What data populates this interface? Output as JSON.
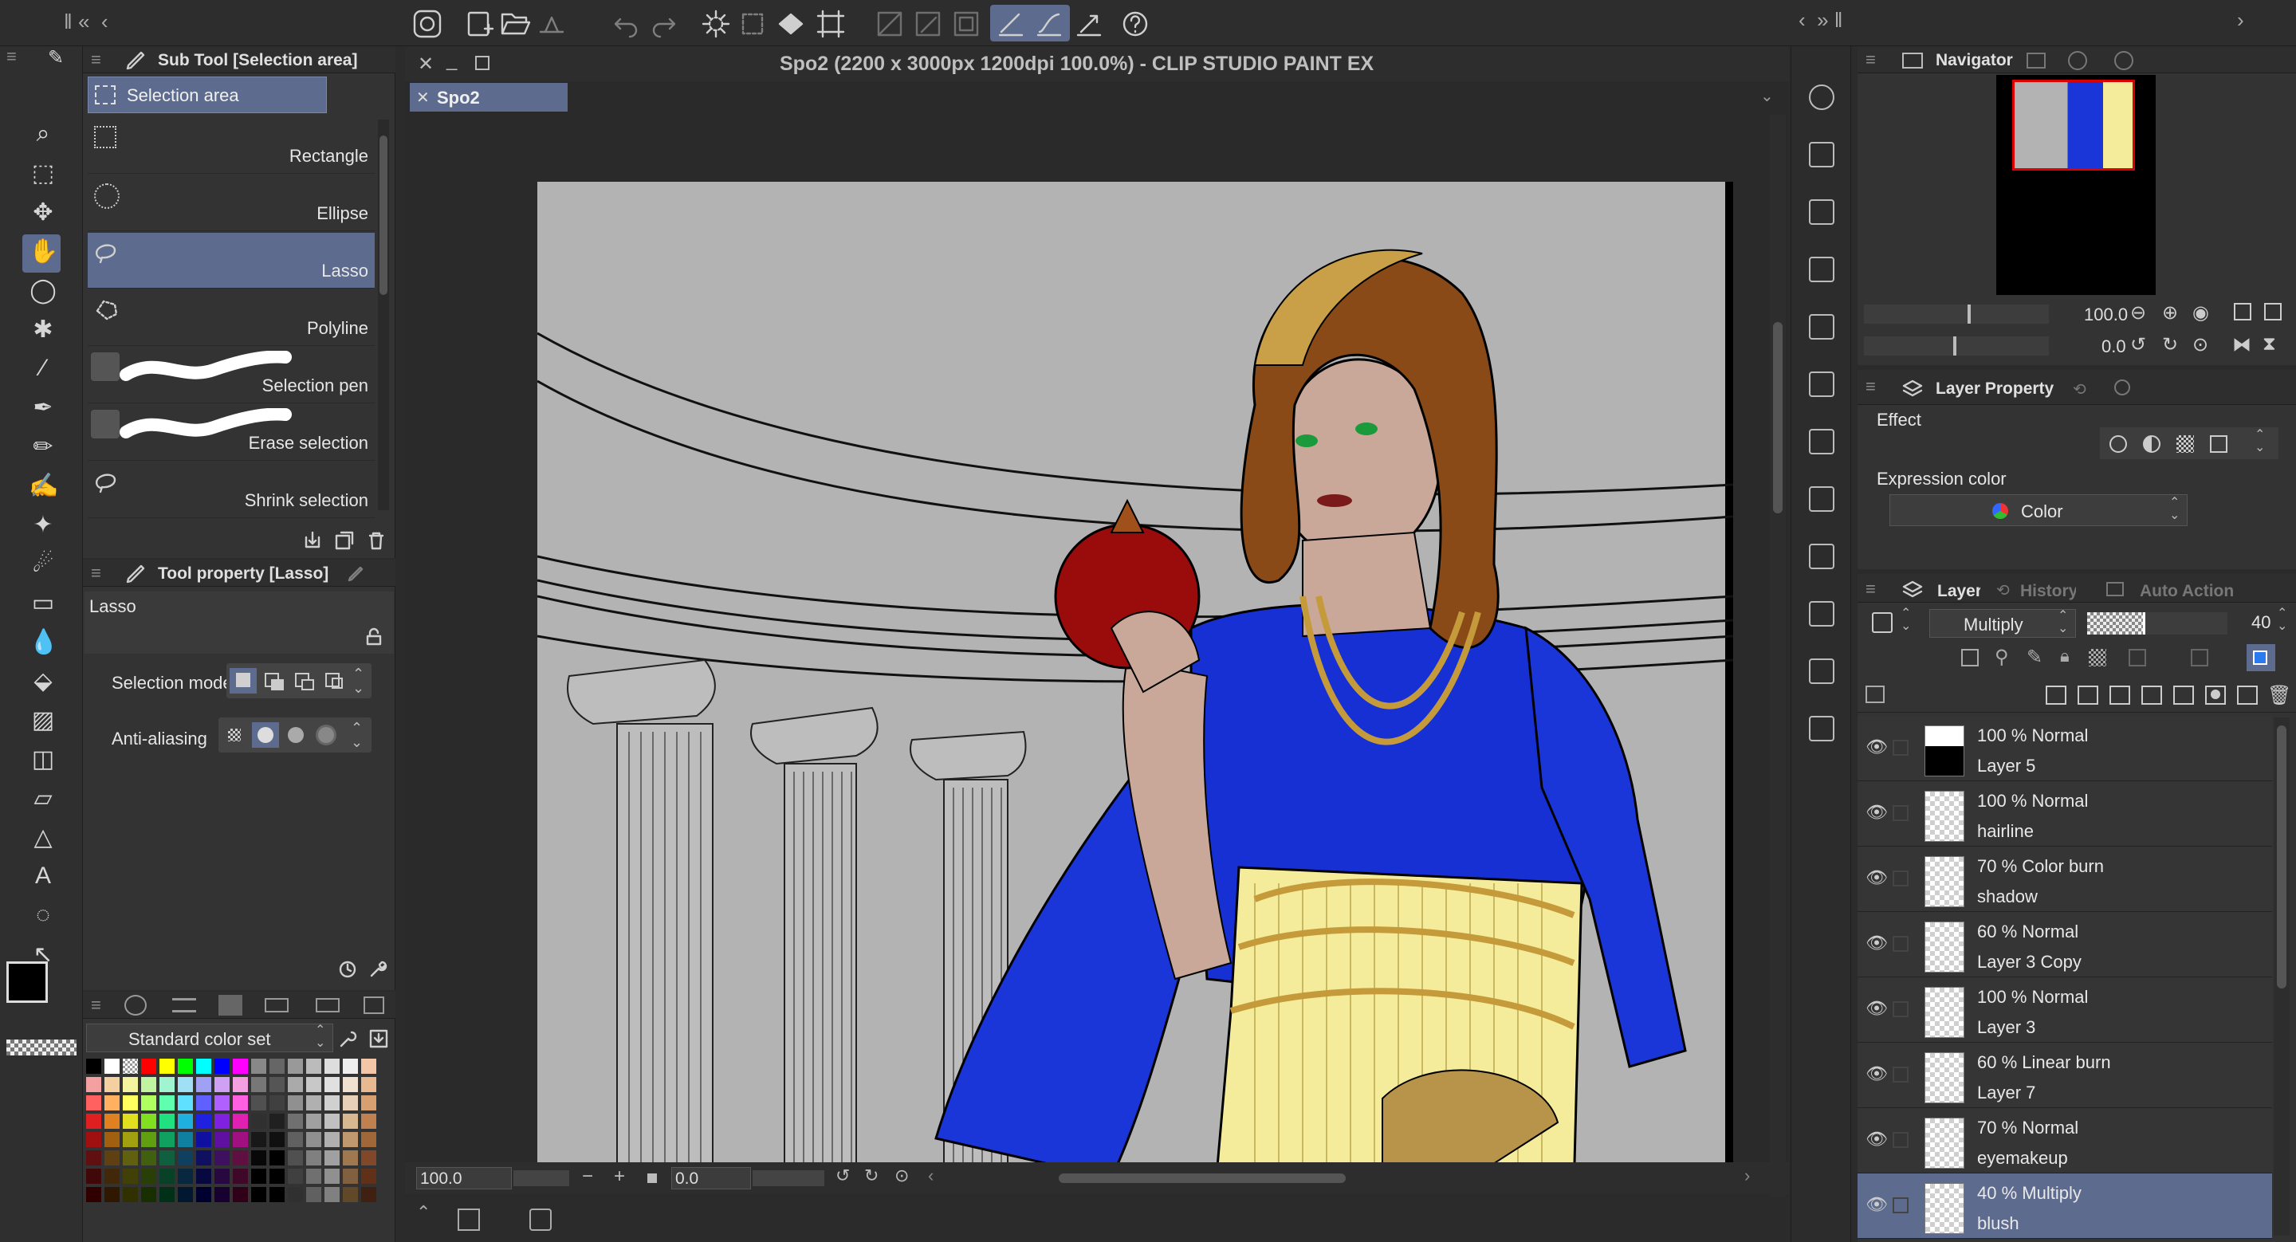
{
  "window": {
    "title": "Spo2 (2200 x 3000px 1200dpi 100.0%)  - CLIP STUDIO PAINT EX",
    "canvas_tab": "Spo2"
  },
  "sub_tool": {
    "header": "Sub Tool [Selection area]",
    "group_tab": "Selection area",
    "items": [
      {
        "label": "Rectangle"
      },
      {
        "label": "Ellipse"
      },
      {
        "label": "Lasso"
      },
      {
        "label": "Polyline"
      },
      {
        "label": "Selection pen"
      },
      {
        "label": "Erase selection"
      },
      {
        "label": "Shrink selection"
      }
    ]
  },
  "tool_property": {
    "header": "Tool property [Lasso]",
    "tool_name": "Lasso",
    "selection_mode_label": "Selection mode",
    "antialiasing_label": "Anti-aliasing"
  },
  "color_set": {
    "name": "Standard color set"
  },
  "status_bar": {
    "zoom": "100.0",
    "rotation": "0.0"
  },
  "navigator": {
    "title": "Navigator",
    "zoom": "100.0",
    "rotation": "0.0"
  },
  "layer_property": {
    "title": "Layer Property",
    "effect_label": "Effect",
    "expression_color_label": "Expression color",
    "expression_color_value": "Color"
  },
  "layer_panel": {
    "tabs": [
      "Layer",
      "History",
      "Auto Action"
    ],
    "blend_mode": "Multiply",
    "opacity": "40",
    "layers": [
      {
        "mode": "100 %  Normal",
        "name": "Layer 5"
      },
      {
        "mode": "100 %  Normal",
        "name": "hairline"
      },
      {
        "mode": "70 %  Color burn",
        "name": "shadow"
      },
      {
        "mode": "60 %  Normal",
        "name": "Layer 3 Copy"
      },
      {
        "mode": "100 %  Normal",
        "name": "Layer 3"
      },
      {
        "mode": "60 %  Linear burn",
        "name": "Layer 7"
      },
      {
        "mode": "70 %  Normal",
        "name": "eyemakeup"
      },
      {
        "mode": "40 %  Multiply",
        "name": "blush"
      }
    ]
  },
  "colors": {
    "accent": "#5d6b8e",
    "panel": "#333333",
    "background": "#2b2b2b",
    "canvas_bg": "#b3b3b3",
    "dress_blue": "#1830d8",
    "skirt_yellow": "#f4ec9a"
  },
  "icons": {
    "toolbar": [
      "app-logo-icon",
      "new-icon",
      "open-icon",
      "save-icon",
      "undo-icon",
      "redo-icon",
      "brightness-icon",
      "crop-icon",
      "fill-icon",
      "transform-icon",
      "snap-ruler-icon",
      "snap-special-icon",
      "snap-grid-icon",
      "help-icon"
    ],
    "tools": [
      "pen-icon",
      "zoom-icon",
      "operation-icon",
      "move-icon",
      "hand-icon",
      "lasso-icon",
      "auto-select-icon",
      "eyedropper-icon",
      "pen2-icon",
      "pencil-icon",
      "brush-icon",
      "decoration-icon",
      "airbrush-icon",
      "eraser-icon",
      "blend-icon",
      "fill-icon",
      "gradient-icon",
      "figure-icon",
      "frame-icon",
      "ruler-icon",
      "text-icon",
      "balloon-icon",
      "correct-line-icon"
    ]
  }
}
